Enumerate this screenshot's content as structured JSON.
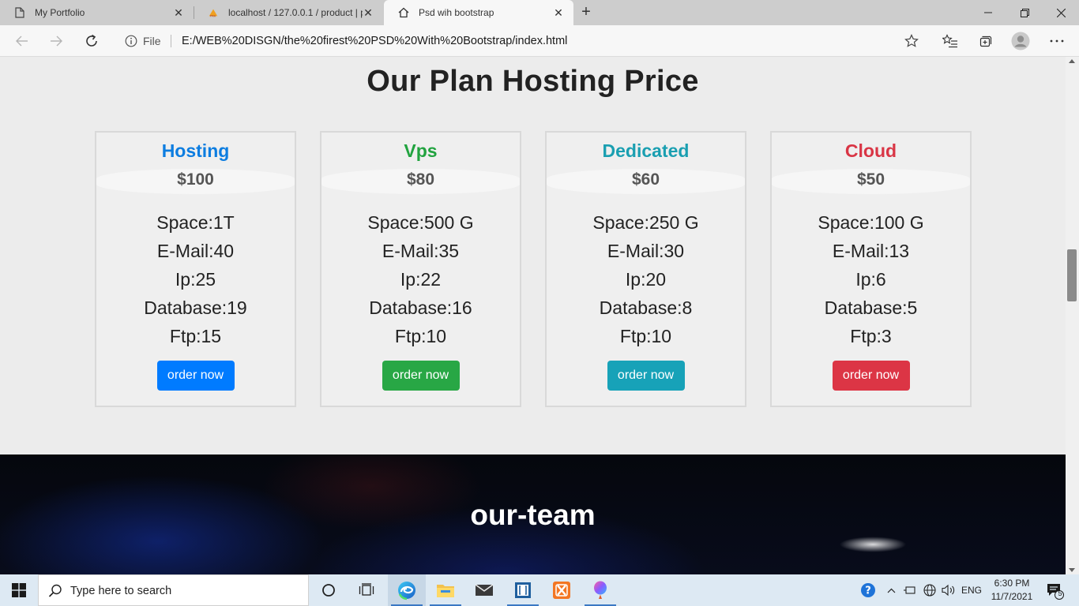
{
  "browser": {
    "tabs": [
      {
        "title": "My Portfolio",
        "active": false
      },
      {
        "title": "localhost / 127.0.0.1 / product | p",
        "active": false
      },
      {
        "title": "Psd wih bootstrap",
        "active": true
      }
    ],
    "address": {
      "scheme_label": "File",
      "url": "E:/WEB%20DISGN/the%20firest%20PSD%20With%20Bootstrap/index.html"
    }
  },
  "pricing": {
    "title": "Our Plan Hosting Price",
    "plans": [
      {
        "name": "Hosting",
        "price": "$100",
        "color": "#0d7de0",
        "button_color": "#007bff",
        "features": [
          "Space:1T",
          "E-Mail:40",
          "Ip:25",
          "Database:19",
          "Ftp:15"
        ],
        "button": "order now"
      },
      {
        "name": "Vps",
        "price": "$80",
        "color": "#21a33f",
        "button_color": "#28a745",
        "features": [
          "Space:500 G",
          "E-Mail:35",
          "Ip:22",
          "Database:16",
          "Ftp:10"
        ],
        "button": "order now"
      },
      {
        "name": "Dedicated",
        "price": "$60",
        "color": "#1a9fb1",
        "button_color": "#17a2b8",
        "features": [
          "Space:250 G",
          "E-Mail:30",
          "Ip:20",
          "Database:8",
          "Ftp:10"
        ],
        "button": "order now"
      },
      {
        "name": "Cloud",
        "price": "$50",
        "color": "#d93545",
        "button_color": "#dc3545",
        "features": [
          "Space:100 G",
          "E-Mail:13",
          "Ip:6",
          "Database:5",
          "Ftp:3"
        ],
        "button": "order now"
      }
    ]
  },
  "team": {
    "title": "our-team"
  },
  "taskbar": {
    "search_placeholder": "Type here to search",
    "language": "ENG",
    "time": "6:30 PM",
    "date": "11/7/2021",
    "notification_count": "5"
  }
}
